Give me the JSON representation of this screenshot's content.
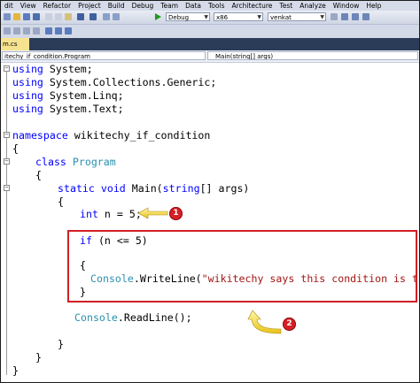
{
  "menu": [
    "dit",
    "View",
    "Refactor",
    "Project",
    "Build",
    "Debug",
    "Team",
    "Data",
    "Tools",
    "Architecture",
    "Test",
    "Analyze",
    "Window",
    "Help"
  ],
  "toolbar": {
    "config": "Debug",
    "platform": "x86",
    "find": "venkat"
  },
  "tab": {
    "label": "m.cs"
  },
  "nav": {
    "left": "itechy_if_condition.Program",
    "right": "Main(string[] args)"
  },
  "code": {
    "l1": "using",
    "l1b": " System;",
    "l2": "using",
    "l2b": " System.Collections.Generic;",
    "l3": "using",
    "l3b": " System.Linq;",
    "l4": "using",
    "l4b": " System.Text;",
    "l5": "namespace",
    "l5b": " wikitechy_if_condition",
    "l6": "{",
    "l7a": "class",
    "l7b": "Program",
    "l8": "{",
    "l9a": "static void",
    "l9b": " Main(",
    "l9c": "string",
    "l9d": "[] args)",
    "l10": "{",
    "l11a": "int",
    "l11b": " n = 5;",
    "l12a": "if",
    "l12b": " (n <= 5)",
    "l13": "{",
    "l14a": "Console",
    "l14b": ".WriteLine(",
    "l14c": "\"wikitechy says this condition is true\"",
    "l14d": ");",
    "l15": "}",
    "l16a": "Console",
    "l16b": ".ReadLine();",
    "l17": "}",
    "l18": "}",
    "l19": "}"
  },
  "callouts": {
    "one": "1",
    "two": "2"
  },
  "colors": {
    "callout": "#d71f27",
    "keyword": "#0000ff",
    "type": "#2b91af",
    "string": "#a31515"
  }
}
